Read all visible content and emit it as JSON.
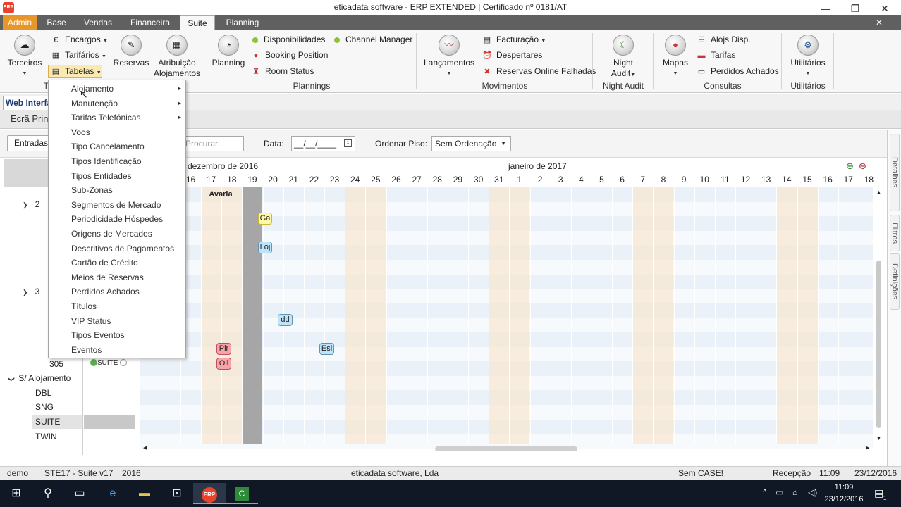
{
  "window": {
    "title": "eticadata software - ERP EXTENDED | Certificado nº 0181/AT",
    "logo_text": "ERP",
    "minimize": "—",
    "maximize": "❐",
    "close": "✕"
  },
  "menu_tabs": [
    "Admin",
    "Base",
    "Vendas",
    "Financeira",
    "Suite",
    "Planning"
  ],
  "menu_close": "✕",
  "ribbon": {
    "terceiros": "Terceiros",
    "encargos": "Encargos",
    "tarifarios": "Tarifários",
    "tabelas": "Tabelas",
    "group_tabelas_partial": "Ta",
    "reservas": "Reservas",
    "atribuicao": [
      "Atribuição",
      "Alojamentos"
    ],
    "planning": "Planning",
    "disponibilidades": "Disponibilidades",
    "channel_manager": "Channel Manager",
    "booking_position": "Booking Position",
    "room_status": "Room Status",
    "group_plannings": "Plannings",
    "lancamentos": "Lançamentos",
    "facturacao": "Facturação",
    "despertares": "Despertares",
    "reservas_online": "Reservas Online Falhadas",
    "group_movimentos": "Movimentos",
    "night_audit": [
      "Night",
      "Audit"
    ],
    "group_night_audit": "Night Audit",
    "mapas": "Mapas",
    "alojs_disp": "Alojs Disp.",
    "tarifas": "Tarifas",
    "perdidos_achados": "Perdidos Achados",
    "group_consultas": "Consultas",
    "utilitarios": "Utilitários",
    "group_utilitarios": "Utilitários"
  },
  "dropdown_items": [
    {
      "label": "Alojamento",
      "submenu": true
    },
    {
      "label": "Manutenção",
      "submenu": true
    },
    {
      "label": "Tarifas Telefónicas",
      "submenu": true
    },
    {
      "label": "Voos",
      "submenu": false
    },
    {
      "label": "Tipo Cancelamento",
      "submenu": false
    },
    {
      "label": "Tipos Identificação",
      "submenu": false
    },
    {
      "label": "Tipos Entidades",
      "submenu": false
    },
    {
      "label": "Sub-Zonas",
      "submenu": false
    },
    {
      "label": "Segmentos de Mercado",
      "submenu": false
    },
    {
      "label": "Periodicidade Hóspedes",
      "submenu": false
    },
    {
      "label": "Origens de Mercados",
      "submenu": false
    },
    {
      "label": "Descritivos de Pagamentos",
      "submenu": false
    },
    {
      "label": "Cartão de Crédito",
      "submenu": false
    },
    {
      "label": "Meios de Reservas",
      "submenu": false
    },
    {
      "label": "Perdidos Achados",
      "submenu": false
    },
    {
      "label": "Títulos",
      "submenu": false
    },
    {
      "label": "VIP Status",
      "submenu": false
    },
    {
      "label": "Tipos Eventos",
      "submenu": false
    },
    {
      "label": "Eventos",
      "submenu": false
    }
  ],
  "dropdown_arrow": "▸",
  "doc_tabs": {
    "web": "Web Interface",
    "ecra": "Ecrã Principal"
  },
  "toolbar": {
    "entradas": "Entradas",
    "search_placeholder": "Procurar...",
    "data_label": "Data:",
    "date_value": "__/__/____",
    "ordenar_label": "Ordenar Piso:",
    "order_value": "Sem Ordenação"
  },
  "planner": {
    "month_left": "dezembro de 2016",
    "month_right": "janeiro de 2017",
    "days": [
      "16",
      "17",
      "18",
      "19",
      "20",
      "21",
      "22",
      "23",
      "24",
      "25",
      "26",
      "27",
      "28",
      "29",
      "30",
      "31",
      "1",
      "2",
      "3",
      "4",
      "5",
      "6",
      "7",
      "8",
      "9",
      "10",
      "11",
      "12",
      "13",
      "14",
      "15",
      "16",
      "17",
      "18"
    ],
    "avaria": "Avaria",
    "floors": [
      "2",
      "3"
    ],
    "room_305": "305",
    "room_305_type": "SUITE",
    "unassigned": "S/ Alojamento",
    "room_types": [
      "DBL",
      "SNG",
      "SUITE",
      "TWIN"
    ],
    "bookings": [
      "Ga",
      "Loj",
      "dd",
      "Pir",
      "Esl",
      "Oli"
    ]
  },
  "side_tabs": [
    "Detalhes",
    "Filtros",
    "Definições"
  ],
  "status": {
    "user": "demo",
    "company": "STE17 - Suite v17",
    "year": "2016",
    "vendor": "eticadata software, Lda",
    "case": "Sem CASE!",
    "module": "Recepção",
    "time": "11:09",
    "date": "23/12/2016"
  },
  "taskbar": {
    "clock_time": "11:09",
    "clock_date": "23/12/2016",
    "notification_badge": "1"
  },
  "colors": {
    "admin_tab": "#e8952a",
    "weekend_col": "#f7e7d2",
    "today_col": "#a6a6a6",
    "taskbar": "#101826"
  }
}
